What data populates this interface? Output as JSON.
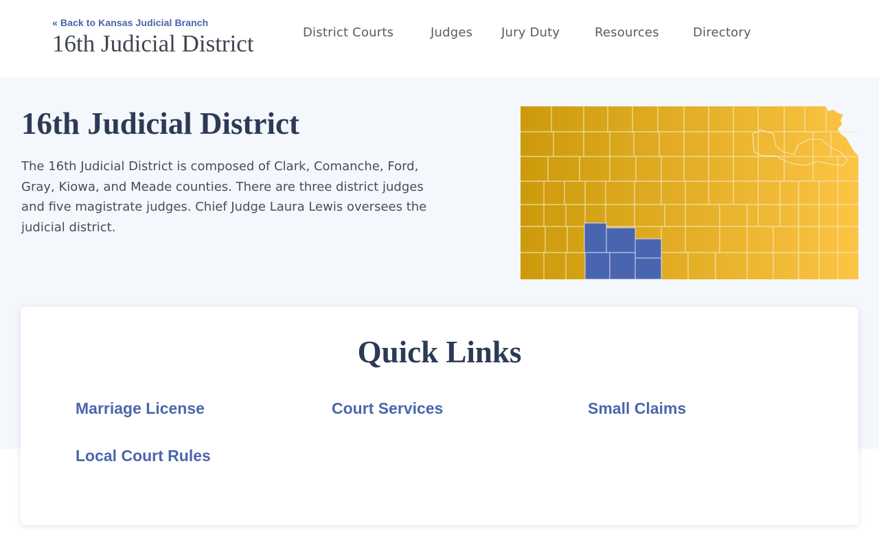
{
  "header": {
    "back_link": "« Back to Kansas Judicial Branch",
    "site_title": "16th Judicial District"
  },
  "nav": {
    "items": [
      "District Courts",
      "Judges",
      "Jury Duty",
      "Resources",
      "Directory"
    ]
  },
  "hero": {
    "title": "16th Judicial District",
    "description": "The 16th Judicial District is composed of Clark, Comanche, Ford, Gray, Kiowa, and Meade counties. There are three district judges and five magistrate judges. Chief Judge Laura Lewis oversees the judicial district."
  },
  "quick_links": {
    "title": "Quick Links",
    "items": [
      "Marriage License",
      "Court Services",
      "Small Claims",
      "Local Court Rules"
    ]
  },
  "colors": {
    "link_blue": "#4a66ad",
    "map_gold_start": "#cc9a0b",
    "map_gold_end": "#fcc443",
    "district_highlight": "#4a65b0",
    "hero_background": "#f4f7fc"
  }
}
